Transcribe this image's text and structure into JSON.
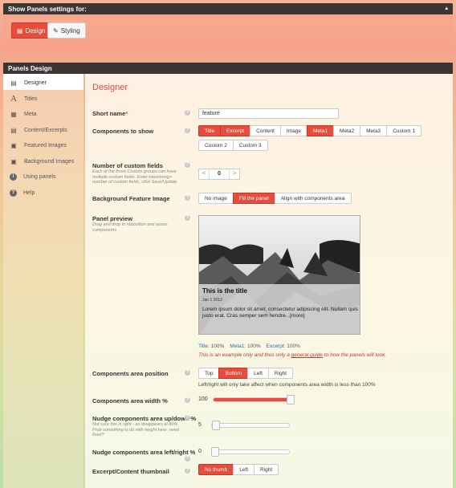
{
  "top_panel": {
    "title": "Show Panels settings for:",
    "collapse_glyph": "▴",
    "buttons": [
      {
        "label": "Design",
        "icon": "design-icon",
        "active": true
      },
      {
        "label": "Styling",
        "icon": "pencil-icon",
        "active": false
      }
    ]
  },
  "panels_design": {
    "title": "Panels Design"
  },
  "sidebar": {
    "items": [
      {
        "label": "Designer",
        "icon": "designer-icon",
        "glyph": "▤",
        "active": true
      },
      {
        "label": "Titles",
        "icon": "titles-icon",
        "glyph": "A"
      },
      {
        "label": "Meta",
        "icon": "meta-icon",
        "glyph": "▦"
      },
      {
        "label": "Content/Excerpts",
        "icon": "content-icon",
        "glyph": "▤"
      },
      {
        "label": "Featured Images",
        "icon": "image-icon",
        "glyph": "▣"
      },
      {
        "label": "Background Images",
        "icon": "background-image-icon",
        "glyph": "▣"
      },
      {
        "label": "Using panels",
        "icon": "info-icon",
        "glyph": "i"
      },
      {
        "label": "Help",
        "icon": "help-icon",
        "glyph": "?"
      }
    ]
  },
  "main": {
    "title": "Designer",
    "help_glyph": "?",
    "short_name": {
      "label": "Short name",
      "required_mark": "*",
      "value": "feature"
    },
    "components": {
      "label": "Components to show",
      "options": [
        {
          "label": "Title",
          "on": true
        },
        {
          "label": "Excerpt",
          "on": true
        },
        {
          "label": "Content",
          "on": false
        },
        {
          "label": "Image",
          "on": false
        },
        {
          "label": "Meta1",
          "on": true
        },
        {
          "label": "Meta2",
          "on": false
        },
        {
          "label": "Meta3",
          "on": false
        },
        {
          "label": "Custom 1",
          "on": false
        },
        {
          "label": "Custom 2",
          "on": false
        },
        {
          "label": "Custom 3",
          "on": false
        }
      ]
    },
    "custom_fields": {
      "label": "Number of custom fields",
      "desc": "Each of the three Custom groups can have multiple custom fields. Enter totalstrong> number of custom fields, click Save/Update",
      "dec": "<",
      "value": "0",
      "inc": ">"
    },
    "bg_feature": {
      "label": "Background Feature Image",
      "options": [
        {
          "label": "No image",
          "on": false
        },
        {
          "label": "Fill the panel",
          "on": true
        },
        {
          "label": "Align with components area",
          "on": false
        }
      ]
    },
    "preview": {
      "label": "Panel preview",
      "desc": "Drag and drop to reposition and resize components",
      "card_title": "This is the title",
      "card_meta": "Jan 1 2013",
      "card_excerpt": "Lorem ipsum dolor sit amet, consectetur adipiscing elit. Nullam quis justo erat. Cras semper sem hendre...[more]",
      "stats": [
        {
          "name": "Title:",
          "value": "100%"
        },
        {
          "name": "Meta1:",
          "value": "100%"
        },
        {
          "name": "Excerpt:",
          "value": "100%"
        }
      ],
      "note_before": "This is an example only and thus only a ",
      "note_link": "general guide",
      "note_after": " to how the panels will look."
    },
    "components_position": {
      "label": "Components area position",
      "options": [
        {
          "label": "Top",
          "on": false
        },
        {
          "label": "Bottom",
          "on": true
        },
        {
          "label": "Left",
          "on": false
        },
        {
          "label": "Right",
          "on": false
        }
      ],
      "help": "Left/right will only take affect when components area width is less than 100%"
    },
    "components_width": {
      "label": "Components area width %",
      "value": "100",
      "fraction": 1.0
    },
    "nudge_updown": {
      "label": "Nudge components area up/down %",
      "desc": "Not sure this is right - as disappears at 80%. Prob something to do with height here. need fixed?",
      "value": "5",
      "fraction": 0.05
    },
    "nudge_leftright": {
      "label": "Nudge components area left/right %",
      "value": "0",
      "fraction": 0.0
    },
    "thumbnail": {
      "label": "Excerpt/Content thumbnail",
      "options": [
        {
          "label": "No thumb",
          "on": true
        },
        {
          "label": "Left",
          "on": false
        },
        {
          "label": "Right",
          "on": false
        }
      ]
    }
  },
  "colors": {
    "accent": "#e74c3c",
    "link_blue": "#2e6ea6",
    "header_dark": "#3b3533"
  }
}
